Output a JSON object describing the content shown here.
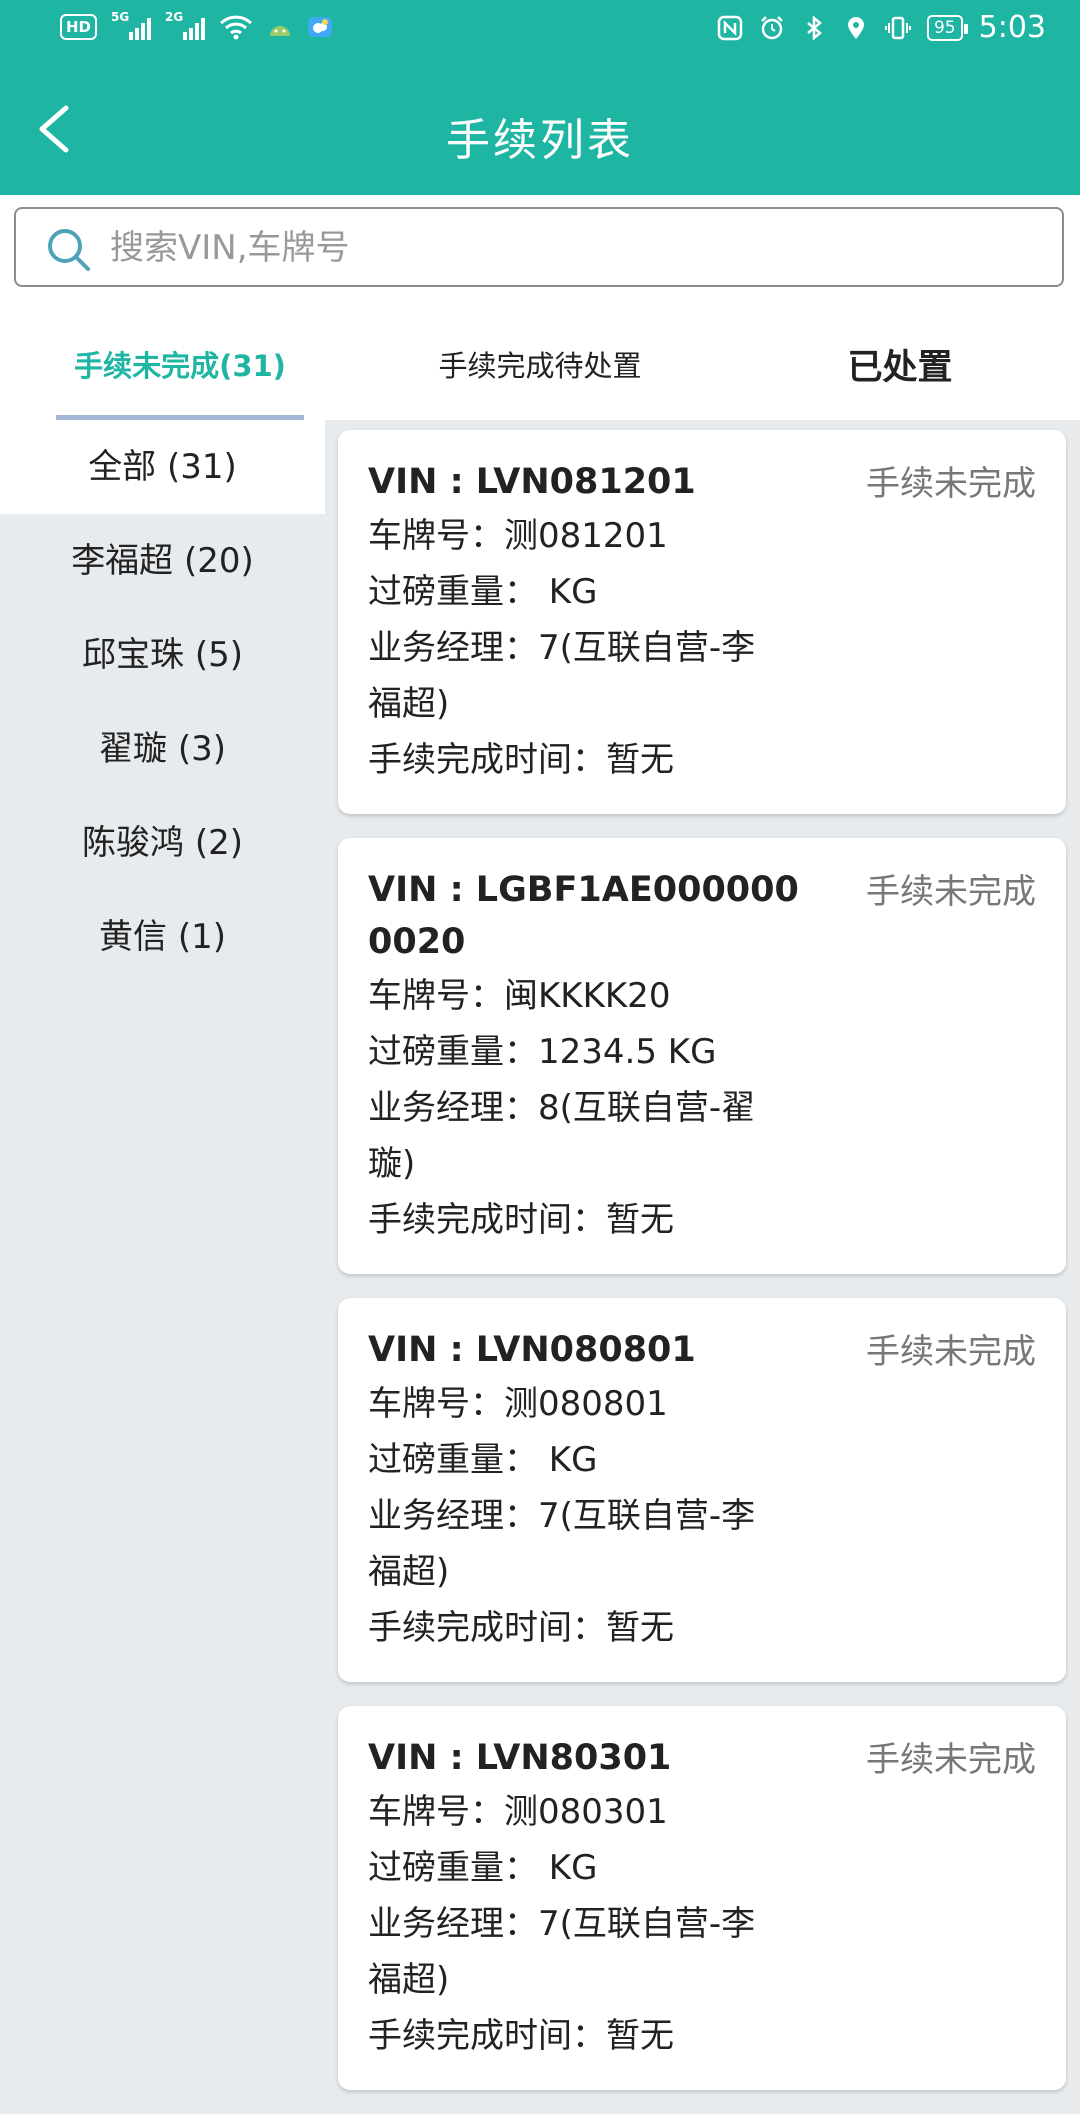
{
  "status_bar": {
    "hd": "HD",
    "sim1": "5G",
    "sim2": "2G",
    "battery": "95",
    "time": "5:03"
  },
  "header": {
    "title": "手续列表",
    "accent_color": "#1fb5a3"
  },
  "search": {
    "placeholder": "搜索VIN,车牌号",
    "value": ""
  },
  "tabs": [
    {
      "label": "手续未完成(31)",
      "active": true
    },
    {
      "label": "手续完成待处置",
      "active": false
    },
    {
      "label": "已处置",
      "active": false
    }
  ],
  "sidebar": {
    "items": [
      {
        "label": "全部 (31)",
        "active": true
      },
      {
        "label": "李福超 (20)"
      },
      {
        "label": "邱宝珠 (5)"
      },
      {
        "label": "翟璇 (3)"
      },
      {
        "label": "陈骏鸿 (2)"
      },
      {
        "label": "黄信 (1)"
      }
    ]
  },
  "records": [
    {
      "vin": "VIN : LVN081201",
      "status": "手续未完成",
      "plate": "车牌号：测081201",
      "weight": "过磅重量：  KG",
      "manager": "业务经理：7(互联自营-李福超)",
      "done_time": "手续完成时间：暂无"
    },
    {
      "vin": "VIN : LGBF1AE0000000020",
      "status": "手续未完成",
      "plate": "车牌号：闽KKKK20",
      "weight": "过磅重量：1234.5 KG",
      "manager": "业务经理：8(互联自营-翟璇)",
      "done_time": "手续完成时间：暂无"
    },
    {
      "vin": "VIN : LVN080801",
      "status": "手续未完成",
      "plate": "车牌号：测080801",
      "weight": "过磅重量：  KG",
      "manager": "业务经理：7(互联自营-李福超)",
      "done_time": "手续完成时间：暂无"
    },
    {
      "vin": "VIN : LVN80301",
      "status": "手续未完成",
      "plate": "车牌号：测080301",
      "weight": "过磅重量：  KG",
      "manager": "业务经理：7(互联自营-李福超)",
      "done_time": "手续完成时间：暂无"
    }
  ]
}
